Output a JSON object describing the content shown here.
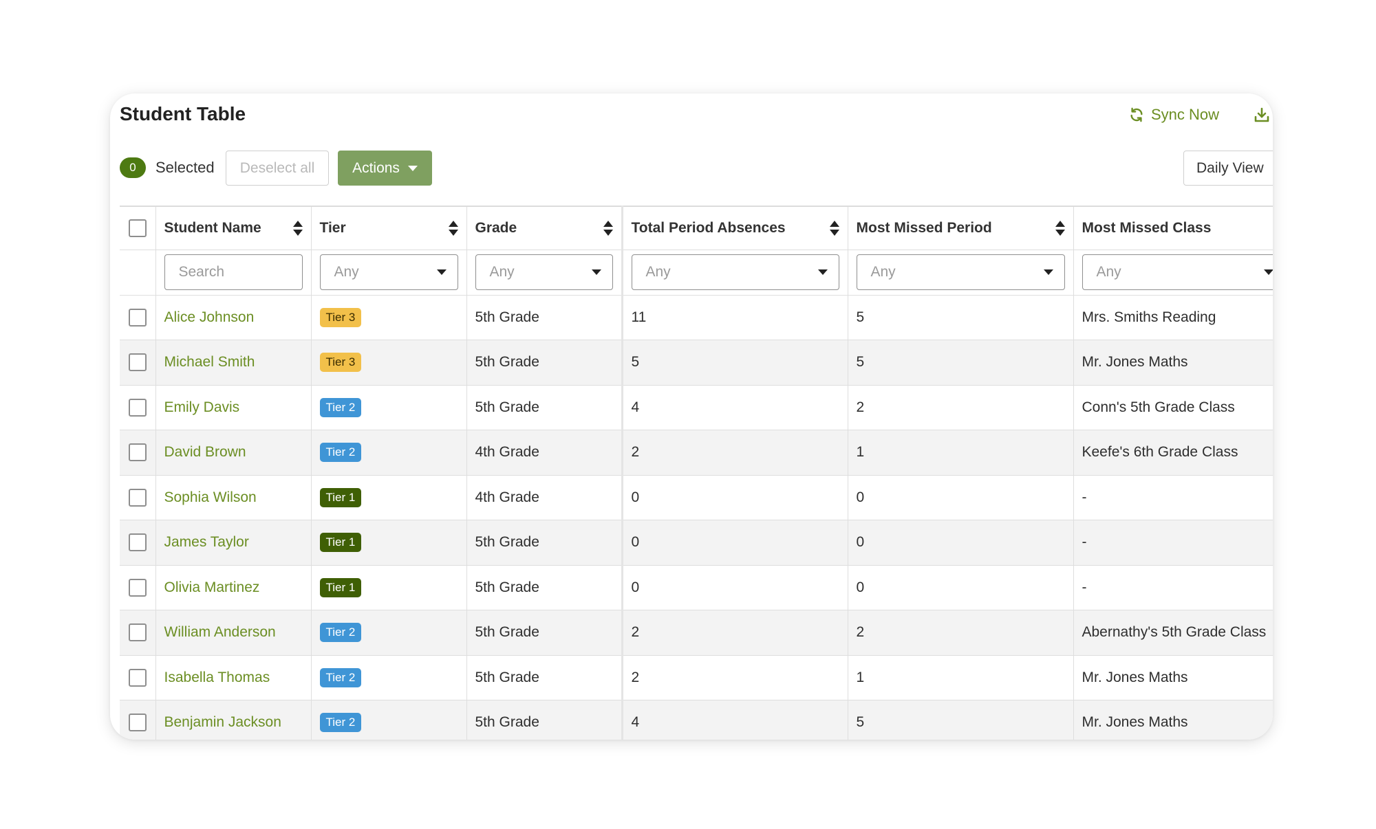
{
  "header": {
    "title": "Student Table",
    "sync_label": "Sync Now"
  },
  "toolbar": {
    "selected_count": "0",
    "selected_label": "Selected",
    "deselect_label": "Deselect all",
    "actions_label": "Actions",
    "daily_view_label": "Daily View"
  },
  "table": {
    "columns": {
      "name": "Student Name",
      "tier": "Tier",
      "grade": "Grade",
      "total": "Total Period Absences",
      "period": "Most Missed Period",
      "class": "Most Missed Class"
    },
    "filters": {
      "search_placeholder": "Search",
      "tier": "Any",
      "grade": "Any",
      "total": "Any",
      "period": "Any",
      "class": "Any"
    },
    "rows": [
      {
        "name": "Alice Johnson",
        "tier": "Tier 3",
        "grade": "5th Grade",
        "total": "11",
        "period": "5",
        "class": "Mrs. Smiths Reading"
      },
      {
        "name": "Michael Smith",
        "tier": "Tier 3",
        "grade": "5th Grade",
        "total": "5",
        "period": "5",
        "class": "Mr. Jones Maths"
      },
      {
        "name": "Emily Davis",
        "tier": "Tier 2",
        "grade": "5th Grade",
        "total": "4",
        "period": "2",
        "class": "Conn's 5th Grade Class"
      },
      {
        "name": "David Brown",
        "tier": "Tier 2",
        "grade": "4th Grade",
        "total": "2",
        "period": "1",
        "class": "Keefe's 6th Grade Class"
      },
      {
        "name": "Sophia Wilson",
        "tier": "Tier 1",
        "grade": "4th Grade",
        "total": "0",
        "period": "0",
        "class": "-"
      },
      {
        "name": "James Taylor",
        "tier": "Tier 1",
        "grade": "5th Grade",
        "total": "0",
        "period": "0",
        "class": "-"
      },
      {
        "name": "Olivia Martinez",
        "tier": "Tier 1",
        "grade": "5th Grade",
        "total": "0",
        "period": "0",
        "class": "-"
      },
      {
        "name": "William Anderson",
        "tier": "Tier 2",
        "grade": "5th Grade",
        "total": "2",
        "period": "2",
        "class": "Abernathy's 5th Grade Class"
      },
      {
        "name": "Isabella Thomas",
        "tier": "Tier 2",
        "grade": "5th Grade",
        "total": "2",
        "period": "1",
        "class": "Mr. Jones Maths"
      },
      {
        "name": "Benjamin Jackson",
        "tier": "Tier 2",
        "grade": "5th Grade",
        "total": "4",
        "period": "5",
        "class": "Mr. Jones Maths"
      }
    ]
  },
  "colors": {
    "accent": "#6b8e23",
    "selected_badge": "#4d7a12",
    "actions_button": "#7fa060",
    "tier_3": "#f2c04a",
    "tier_2": "#3f95d6",
    "tier_1": "#3f5f05"
  },
  "icons": {
    "sync": "sync-icon",
    "download": "download-icon",
    "sort": "sort-icon",
    "dropdown": "chevron-down-icon"
  }
}
